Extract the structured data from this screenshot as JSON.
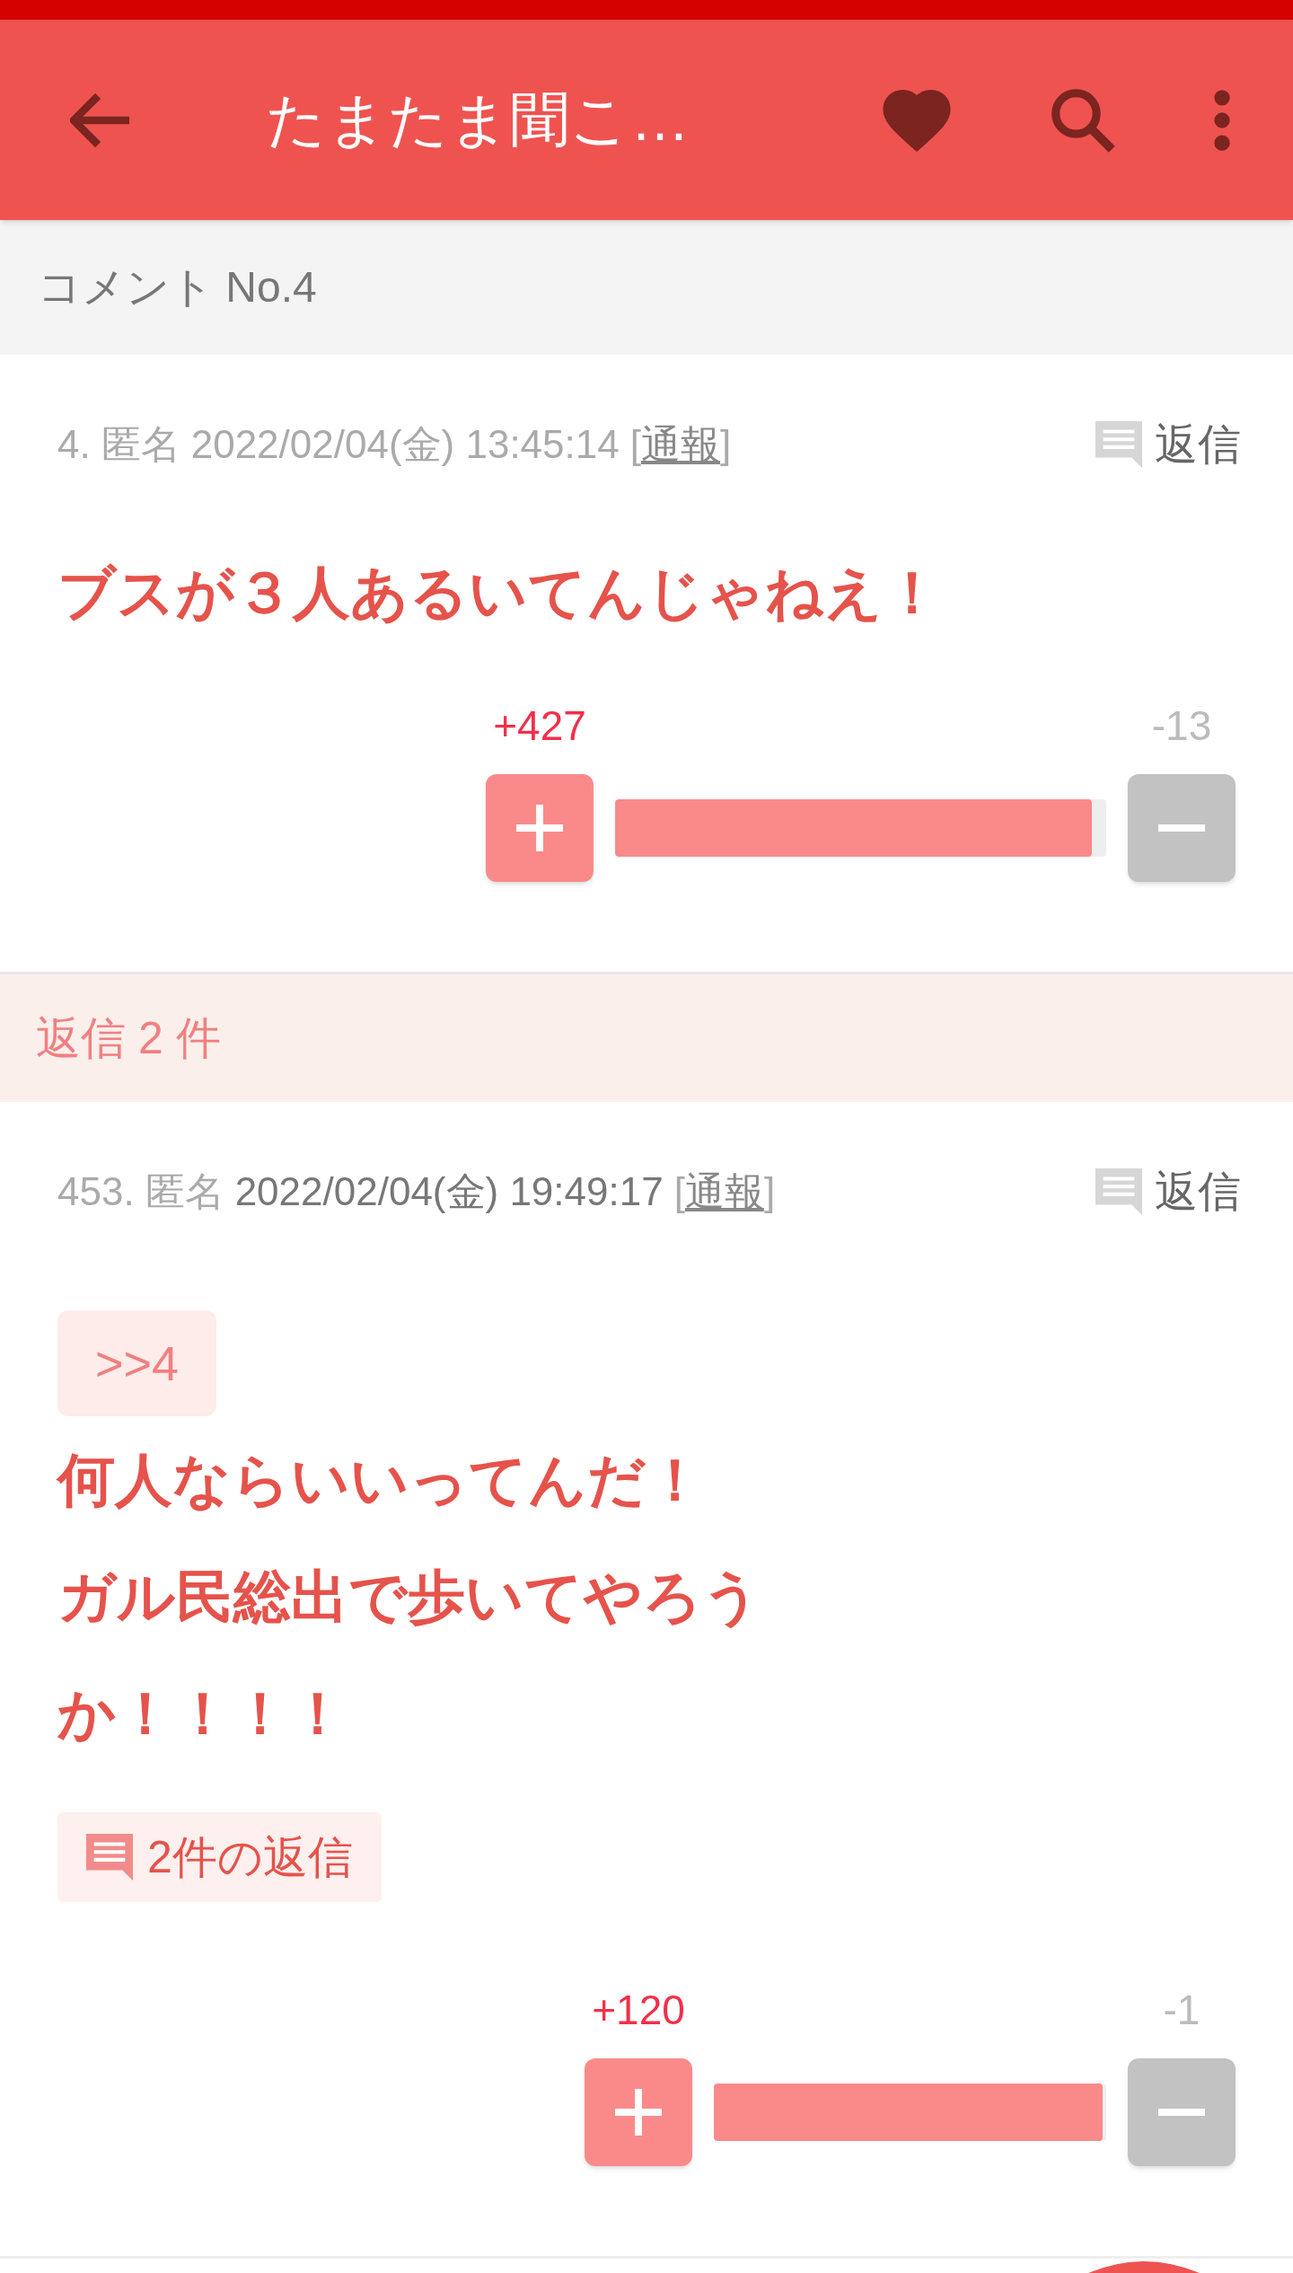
{
  "app_bar": {
    "title": "たまたま聞こ…",
    "favorite": true
  },
  "section_header": "コメント No.4",
  "comments": [
    {
      "number": "4.",
      "name": "匿名",
      "date": "2022/02/04(金) 13:45:14",
      "date_emphasis": false,
      "report_open": "[",
      "report": "通報",
      "report_close": "]",
      "reply_label": "返信",
      "body": [
        "ブスが３人あるいてんじゃねえ！"
      ],
      "plus": "+427",
      "minus": "-13",
      "level": 0.97
    },
    {
      "number": "453.",
      "name": "匿名",
      "date": "2022/02/04(金) 19:49:17",
      "date_emphasis": true,
      "report_open": "[",
      "report": "通報",
      "report_close": "]",
      "reply_label": "返信",
      "anchor": ">>4",
      "body": [
        "何人ならいいってんだ！",
        "ガル民総出で歩いてやろうか！！！！"
      ],
      "replies_link": "2件の返信",
      "plus": "+120",
      "minus": "-1",
      "level": 0.99
    }
  ],
  "replies_header": "返信 2 件"
}
